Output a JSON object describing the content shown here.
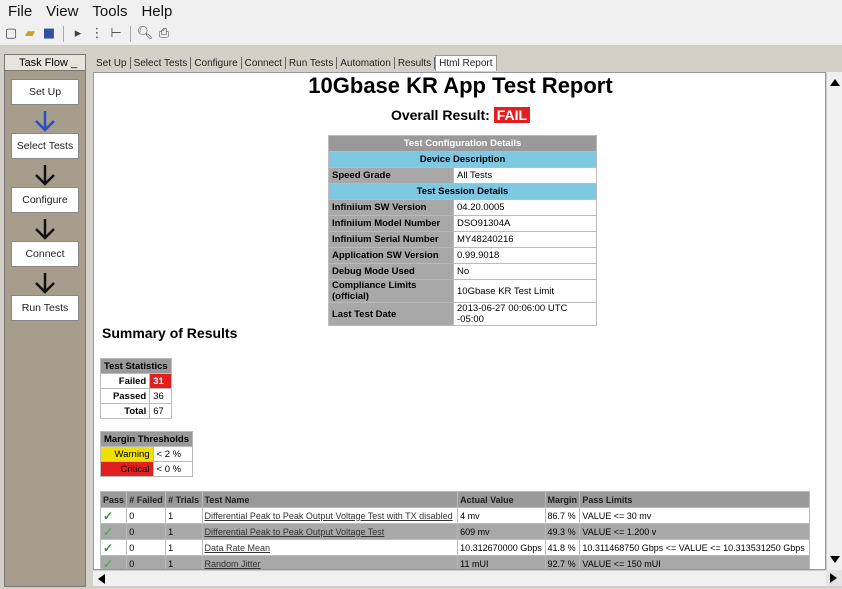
{
  "menu": [
    "File",
    "View",
    "Tools",
    "Help"
  ],
  "toolbar": {
    "icons": [
      "new-icon",
      "open-icon",
      "save-icon",
      "separator",
      "run-icon",
      "step-icon",
      "stop-icon",
      "separator",
      "preview-icon",
      "print-icon"
    ]
  },
  "taskflow": {
    "title": "Task Flow _",
    "steps": [
      "Set Up",
      "Select Tests",
      "Configure",
      "Connect",
      "Run Tests"
    ]
  },
  "tabs": [
    "Set Up",
    "Select Tests",
    "Configure",
    "Connect",
    "Run Tests",
    "Automation",
    "Results",
    "Html Report"
  ],
  "report": {
    "title": "10Gbase KR App Test Report",
    "overall_label": "Overall Result:",
    "overall_value": "FAIL",
    "config_header": "Test Configuration Details",
    "device_header": "Device Description",
    "device_rows": [
      [
        "Speed Grade",
        "All Tests"
      ]
    ],
    "session_header": "Test Session Details",
    "session_rows": [
      [
        "Infiniium SW Version",
        "04.20.0005"
      ],
      [
        "Infiniium Model Number",
        "DSO91304A"
      ],
      [
        "Infiniium Serial Number",
        "MY48240216"
      ],
      [
        "Application SW Version",
        "0.99.9018"
      ],
      [
        "Debug Mode Used",
        "No"
      ],
      [
        "Compliance Limits (official)",
        "10Gbase KR Test Limit"
      ],
      [
        "Last Test Date",
        "2013-06-27 00:06:00 UTC -05:00"
      ]
    ],
    "summary_title": "Summary of Results",
    "stats_header": "Test Statistics",
    "stats": [
      [
        "Failed",
        "31"
      ],
      [
        "Passed",
        "36"
      ],
      [
        "Total",
        "67"
      ]
    ],
    "margin_header": "Margin Thresholds",
    "margins": [
      [
        "Warning",
        "< 2 %"
      ],
      [
        "Critical",
        "< 0 %"
      ]
    ],
    "results_headers": [
      "Pass",
      "# Failed",
      "# Trials",
      "Test Name",
      "Actual Value",
      "Margin",
      "Pass Limits"
    ],
    "results": [
      [
        "✓",
        "0",
        "1",
        "Differential Peak to Peak Output Voltage Test with TX disabled",
        "4 mv",
        "86.7 %",
        "VALUE <= 30 mv"
      ],
      [
        "✓",
        "0",
        "1",
        "Differential Peak to Peak Output Voltage Test",
        "609 mv",
        "49.3 %",
        "VALUE <= 1.200 v"
      ],
      [
        "✓",
        "0",
        "1",
        "Data Rate Mean",
        "10.312670000 Gbps",
        "41.8 %",
        "10.311468750 Gbps <= VALUE <= 10.313531250 Gbps"
      ],
      [
        "✓",
        "0",
        "1",
        "Random Jitter",
        "11 mUI",
        "92.7 %",
        "VALUE <= 150 mUI"
      ]
    ]
  }
}
